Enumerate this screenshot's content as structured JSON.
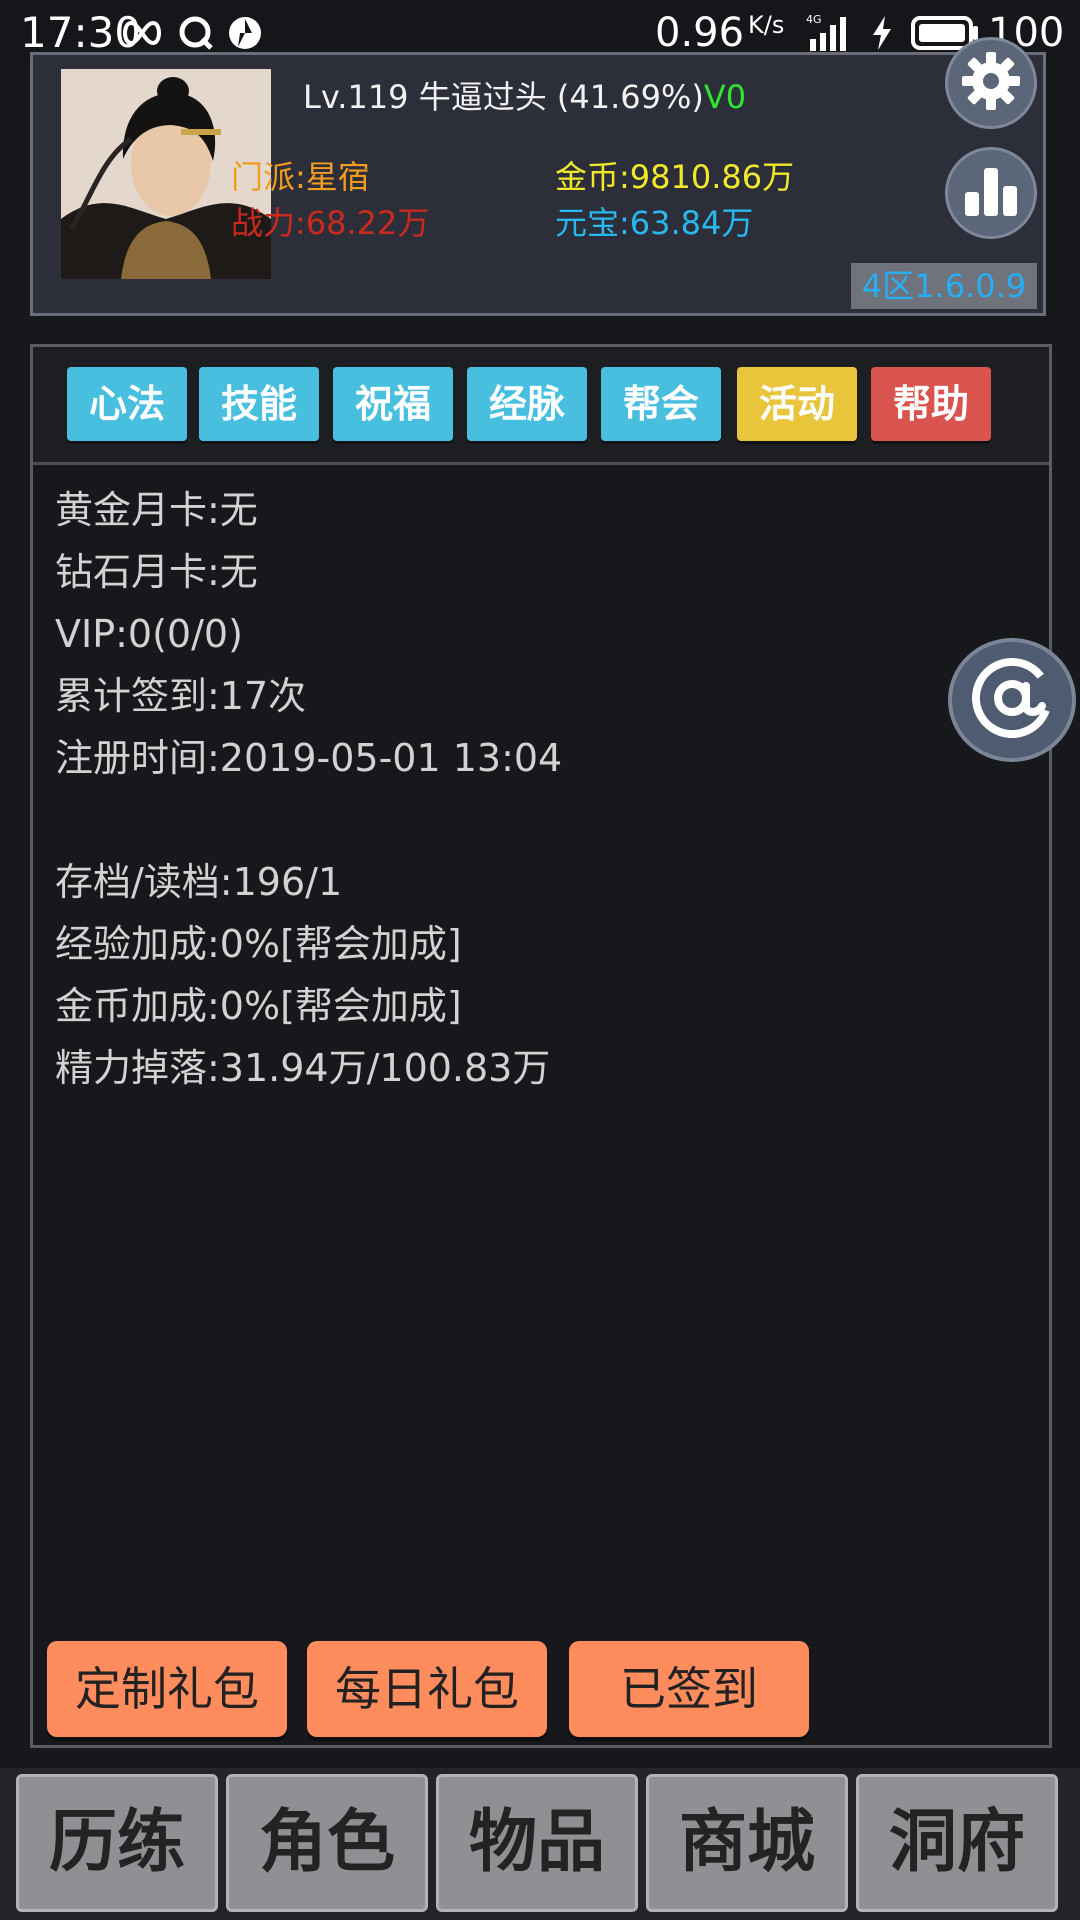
{
  "status_bar": {
    "time": "17:30",
    "net_speed": "0.96",
    "net_unit": "K/s",
    "network": "4G",
    "battery": "100"
  },
  "profile": {
    "level": "Lv.119",
    "name": "牛逼过头",
    "exp": "(41.69%)",
    "vip": "V0",
    "sect": "门派:星宿",
    "power": "战力:68.22万",
    "gold": "金币:9810.86万",
    "ingot": "元宝:63.84万",
    "version": "4区1.6.0.9"
  },
  "tabs": [
    {
      "label": "心法",
      "color": "#49bfe0"
    },
    {
      "label": "技能",
      "color": "#49bfe0"
    },
    {
      "label": "祝福",
      "color": "#49bfe0"
    },
    {
      "label": "经脉",
      "color": "#49bfe0"
    },
    {
      "label": "帮会",
      "color": "#49bfe0"
    },
    {
      "label": "活动",
      "color": "#e8c53a"
    },
    {
      "label": "帮助",
      "color": "#d9534f"
    }
  ],
  "info": [
    "黄金月卡:无",
    "钻石月卡:无",
    "VIP:0(0/0)",
    "累计签到:17次",
    "注册时间:2019-05-01 13:04",
    "",
    "存档/读档:196/1",
    "经验加成:0%[帮会加成]",
    "金币加成:0%[帮会加成]",
    "精力掉落:31.94万/100.83万"
  ],
  "gift_buttons": [
    "定制礼包",
    "每日礼包",
    "已签到"
  ],
  "bottom_nav": [
    "历练",
    "角色",
    "物品",
    "商城",
    "洞府"
  ],
  "colors": {
    "sect": "#f39c1f",
    "power": "#c92a1e",
    "gold": "#f0e92b",
    "ingot": "#29b8ee",
    "vip": "#2ee62e"
  }
}
